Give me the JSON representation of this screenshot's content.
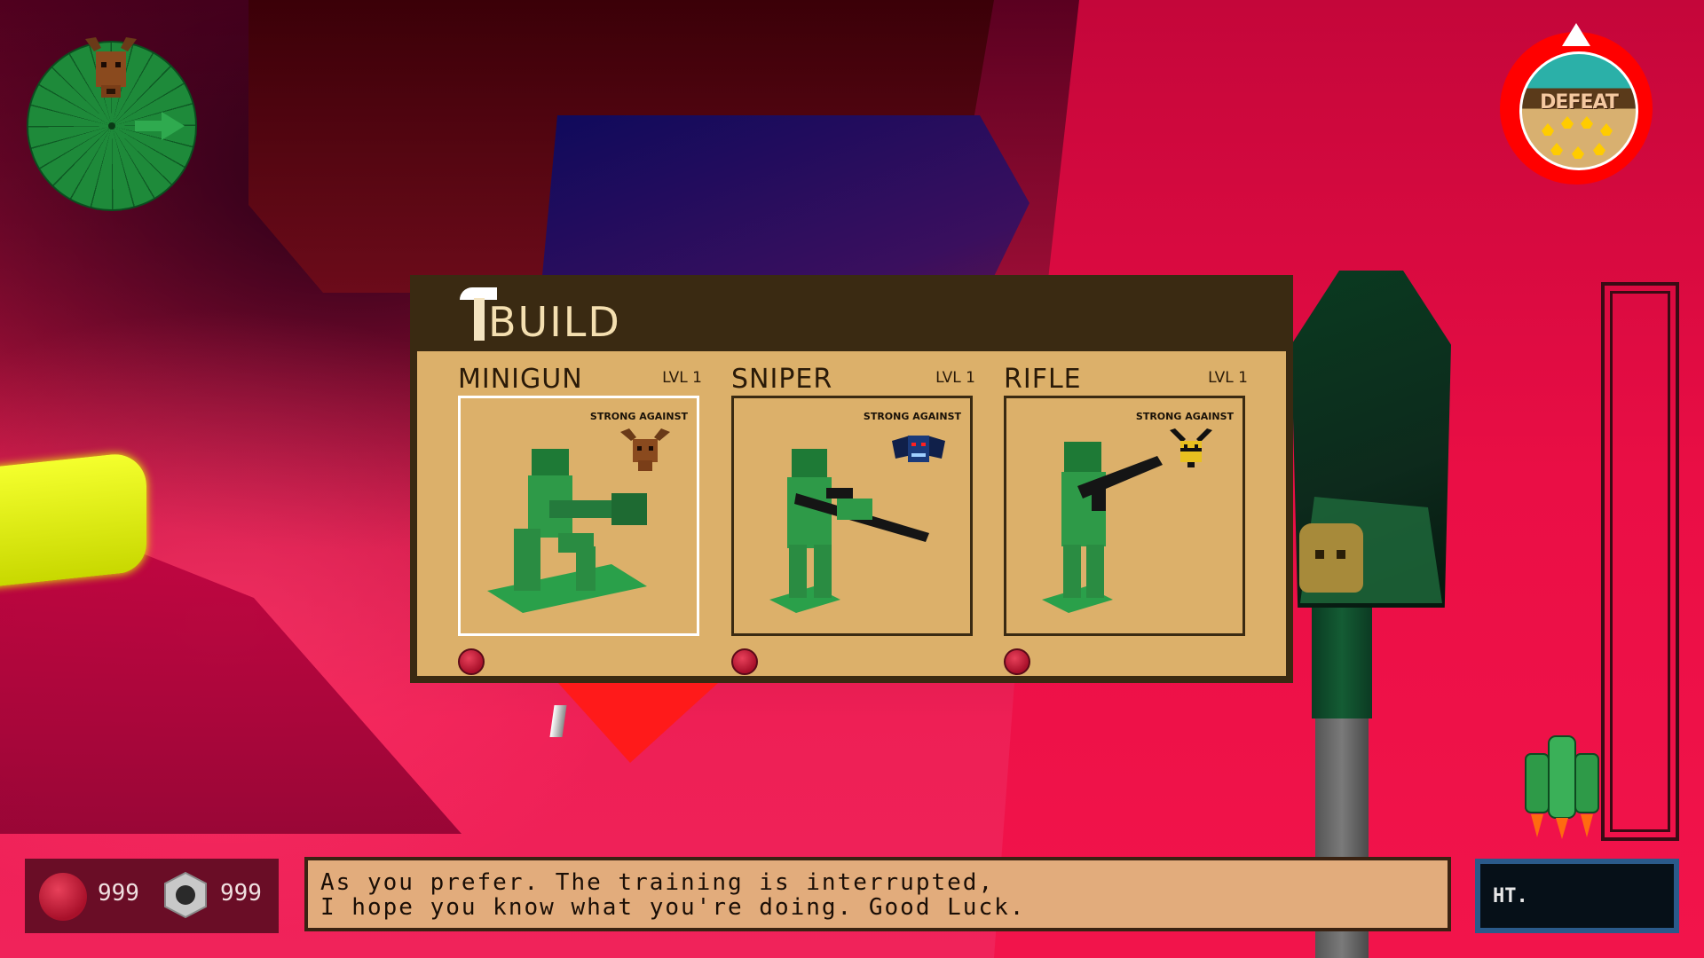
{
  "build_menu": {
    "title": "BUILD",
    "cards": [
      {
        "name": "MINIGUN",
        "level": "LVL 1",
        "strong_label": "STRONG AGAINST",
        "enemy_icon": "deer-icon",
        "selected": true
      },
      {
        "name": "SNIPER",
        "level": "LVL 1",
        "strong_label": "STRONG AGAINST",
        "enemy_icon": "blue-bat-icon",
        "selected": false
      },
      {
        "name": "RIFLE",
        "level": "LVL 1",
        "strong_label": "STRONG AGAINST",
        "enemy_icon": "bee-icon",
        "selected": false
      }
    ]
  },
  "resources": {
    "gems": "999",
    "bolts": "999"
  },
  "dialogue": {
    "line1": "As you prefer. The training is interrupted,",
    "line2": "I hope you know what you're doing. Good Luck."
  },
  "status_badge": {
    "label": "DEFEAT"
  },
  "ht_box": {
    "text": "HT."
  },
  "colors": {
    "accent_red": "#ff0000",
    "panel_brown": "#3a2a12",
    "card_tan": "#dcb06a",
    "soldier_green": "#2e9a48"
  }
}
